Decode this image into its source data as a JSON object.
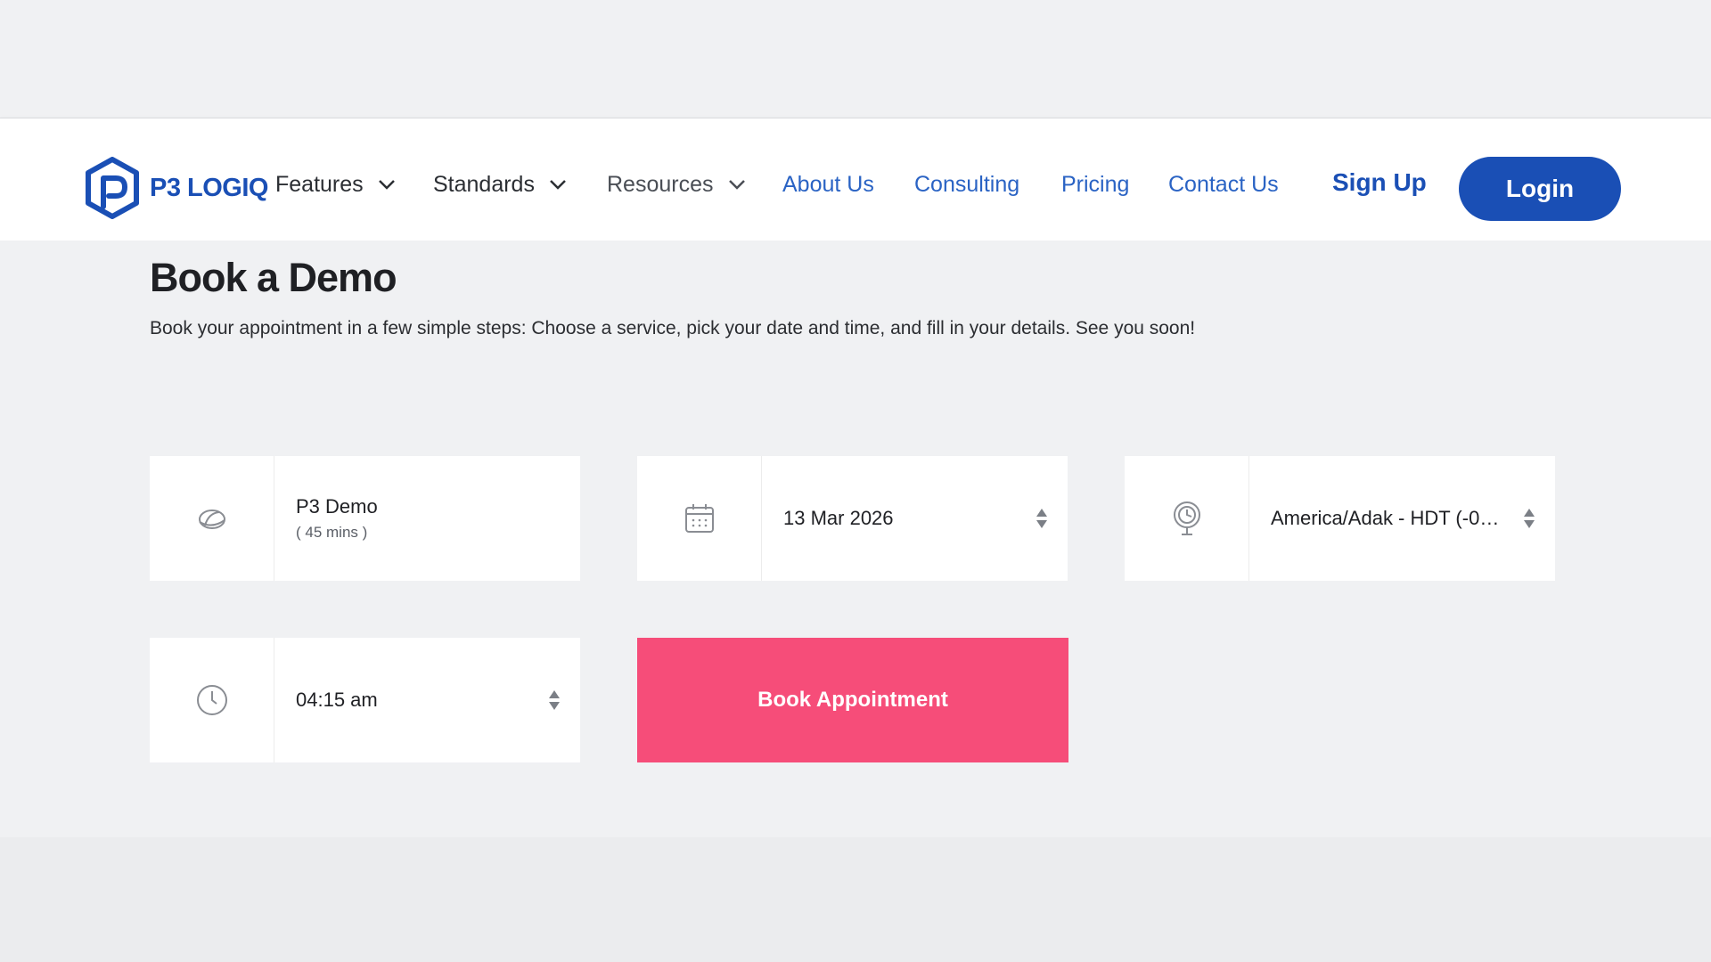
{
  "nav": {
    "brand": "P3 LOGIQ",
    "features": "Features",
    "standards": "Standards",
    "resources": "Resources",
    "about": "About Us",
    "consulting": "Consulting",
    "pricing": "Pricing",
    "contact": "Contact Us",
    "signup": "Sign Up",
    "login": "Login"
  },
  "page": {
    "title": "Book a Demo",
    "subtitle": "Book your appointment in a few simple steps: Choose a service, pick your date and time, and fill in your details. See you soon!"
  },
  "form": {
    "service": {
      "name": "P3 Demo",
      "duration": "( 45 mins )",
      "icon": "service-icon"
    },
    "date": {
      "value": "13 Mar 2026",
      "icon": "calendar-icon"
    },
    "timezone": {
      "value": "America/Adak - HDT (-09:...",
      "icon": "timezone-icon"
    },
    "time": {
      "value": "04:15 am",
      "icon": "clock-icon"
    },
    "submit": "Book Appointment"
  },
  "colors": {
    "brand_blue": "#1a4fb5",
    "link_blue": "#2a63c4",
    "submit_pink": "#f64d79",
    "background": "#f0f1f3"
  }
}
